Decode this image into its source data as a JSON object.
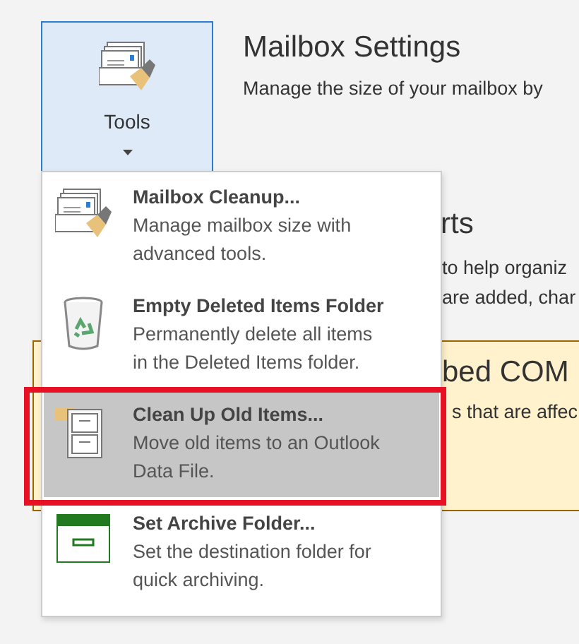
{
  "tools_button": {
    "label": "Tools",
    "pressed": true
  },
  "header": {
    "title": "Mailbox Settings",
    "subtitle": "Manage the size of your mailbox by"
  },
  "background_section": {
    "heading": "rts",
    "lines": [
      "to help organiz",
      "are added, char"
    ]
  },
  "notice": {
    "heading": "bed COM",
    "text": "s that are affec"
  },
  "menu": {
    "items": [
      {
        "title": "Mailbox Cleanup...",
        "description": "Manage mailbox size with advanced tools.",
        "selected": false,
        "highlighted": false
      },
      {
        "title": "Empty Deleted Items Folder",
        "description": "Permanently delete all items in the Deleted Items folder.",
        "selected": false,
        "highlighted": false
      },
      {
        "title": "Clean Up Old Items...",
        "description": "Move old items to an Outlook Data File.",
        "selected": true,
        "highlighted": true
      },
      {
        "title": "Set Archive Folder...",
        "description": "Set the destination folder for quick archiving.",
        "selected": false,
        "highlighted": false
      }
    ]
  }
}
